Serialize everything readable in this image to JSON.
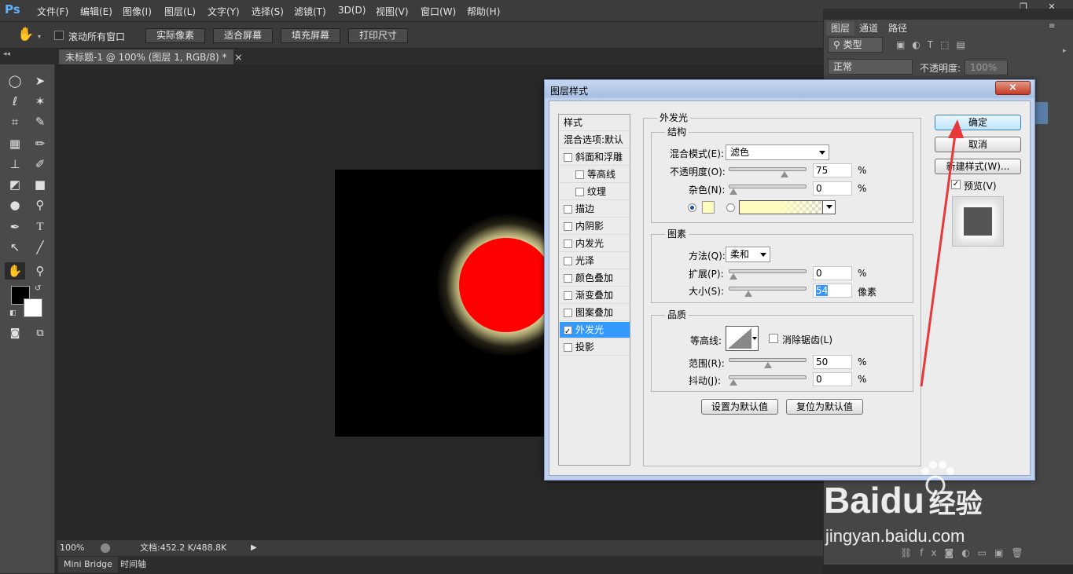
{
  "app": {
    "logo": "Ps"
  },
  "menu": [
    "文件(F)",
    "编辑(E)",
    "图像(I)",
    "图层(L)",
    "文字(Y)",
    "选择(S)",
    "滤镜(T)",
    "3D(D)",
    "视图(V)",
    "窗口(W)",
    "帮助(H)"
  ],
  "options": {
    "scroll_all_label": "滚动所有窗口",
    "actual_pixels": "实际像素",
    "fit_screen": "适合屏幕",
    "fill_screen": "填充屏幕",
    "print_size": "打印尺寸"
  },
  "document_tab": {
    "title": "未标题-1 @ 100% (图层 1, RGB/8) *",
    "close": "×"
  },
  "status": {
    "zoom": "100%",
    "doc_info": "文档:452.2 K/488.8K"
  },
  "bottom_tabs": [
    "Mini Bridge",
    "时间轴"
  ],
  "layers_panel": {
    "tabs": [
      "图层",
      "通道",
      "路径"
    ],
    "filter_kind": "类型",
    "blend_mode": "正常",
    "opacity_label": "不透明度:",
    "opacity_value": "100%"
  },
  "dialog": {
    "title": "图层样式",
    "close": "×",
    "styles_header": "样式",
    "blend_options": "混合选项:默认",
    "style_items": [
      {
        "label": "斜面和浮雕",
        "checked": false,
        "indent": false
      },
      {
        "label": "等高线",
        "checked": false,
        "indent": true
      },
      {
        "label": "纹理",
        "checked": false,
        "indent": true
      },
      {
        "label": "描边",
        "checked": false,
        "indent": false
      },
      {
        "label": "内阴影",
        "checked": false,
        "indent": false
      },
      {
        "label": "内发光",
        "checked": false,
        "indent": false
      },
      {
        "label": "光泽",
        "checked": false,
        "indent": false
      },
      {
        "label": "颜色叠加",
        "checked": false,
        "indent": false
      },
      {
        "label": "渐变叠加",
        "checked": false,
        "indent": false
      },
      {
        "label": "图案叠加",
        "checked": false,
        "indent": false
      },
      {
        "label": "外发光",
        "checked": true,
        "indent": false,
        "selected": true
      },
      {
        "label": "投影",
        "checked": false,
        "indent": false
      }
    ],
    "section_title": "外发光",
    "structure": {
      "title": "结构",
      "blend_mode_label": "混合模式(E):",
      "blend_mode_value": "滤色",
      "opacity_label": "不透明度(O):",
      "opacity_value": "75",
      "opacity_level": 75,
      "noise_label": "杂色(N):",
      "noise_value": "0",
      "noise_level": 0,
      "percent": "%",
      "glow_color": "#fffcc0"
    },
    "elements": {
      "title": "图素",
      "technique_label": "方法(Q):",
      "technique_value": "柔和",
      "spread_label": "扩展(P):",
      "spread_value": "0",
      "spread_level": 0,
      "size_label": "大小(S):",
      "size_value": "54",
      "size_unit": "像素",
      "size_level": 22
    },
    "quality": {
      "title": "品质",
      "contour_label": "等高线:",
      "antialias_label": "消除锯齿(L)",
      "range_label": "范围(R):",
      "range_value": "50",
      "range_level": 50,
      "jitter_label": "抖动(J):",
      "jitter_value": "0",
      "jitter_level": 0
    },
    "make_default": "设置为默认值",
    "reset_default": "复位为默认值",
    "ok": "确定",
    "cancel": "取消",
    "new_style": "新建样式(W)...",
    "preview_label": "预览(V)",
    "preview_checked": true
  },
  "watermark": {
    "brand": "Bai",
    "brand2": "du",
    "cn": "经验",
    "url": "jingyan.baidu.com"
  },
  "colors": {
    "accent": "#3399ff",
    "foreground": "#000000",
    "background": "#ffffff",
    "circle": "#ff0000"
  }
}
